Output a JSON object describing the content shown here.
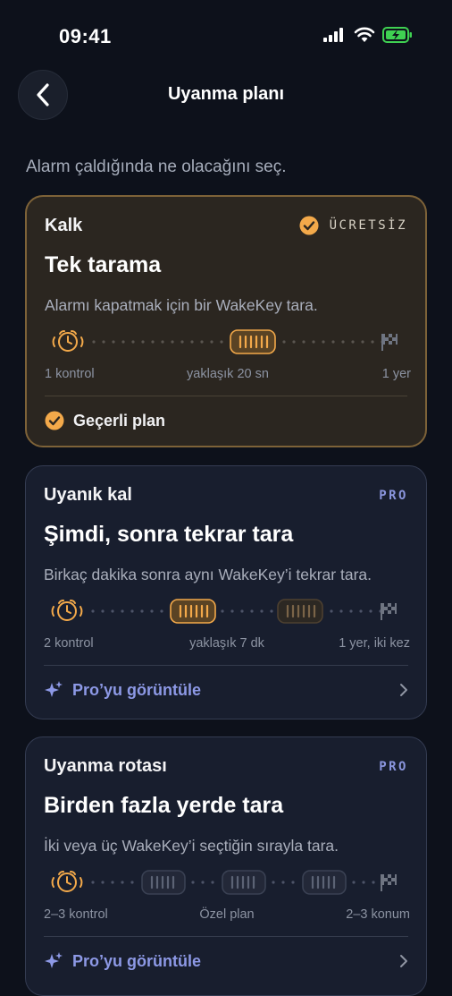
{
  "status": {
    "time": "09:41"
  },
  "header": {
    "title": "Uyanma planı"
  },
  "subtitle": "Alarm çaldığında ne olacağını seç.",
  "colors": {
    "accent": "#f3a94a",
    "pro": "#8a95dd",
    "background": "#0d111b"
  },
  "cards": [
    {
      "label": "Kalk",
      "badge": "ÜCRETSİZ",
      "title": "Tek tarama",
      "description": "Alarmı kapatmak için bir WakeKey tara.",
      "meta": [
        "1 kontrol",
        "yaklaşık 20 sn",
        "1 yer"
      ],
      "footer": "Geçerli plan",
      "selected": true
    },
    {
      "label": "Uyanık kal",
      "badge": "PRO",
      "title": "Şimdi, sonra tekrar tara",
      "description": "Birkaç dakika sonra aynı WakeKey’i tekrar tara.",
      "meta": [
        "2 kontrol",
        "yaklaşık 7 dk",
        "1 yer, iki kez"
      ],
      "footer": "Pro’yu görüntüle",
      "selected": false
    },
    {
      "label": "Uyanma rotası",
      "badge": "PRO",
      "title": "Birden fazla yerde tara",
      "description": "İki veya üç WakeKey’i seçtiğin sırayla tara.",
      "meta": [
        "2–3 kontrol",
        "Özel plan",
        "2–3 konum"
      ],
      "footer": "Pro’yu görüntüle",
      "selected": false
    }
  ]
}
